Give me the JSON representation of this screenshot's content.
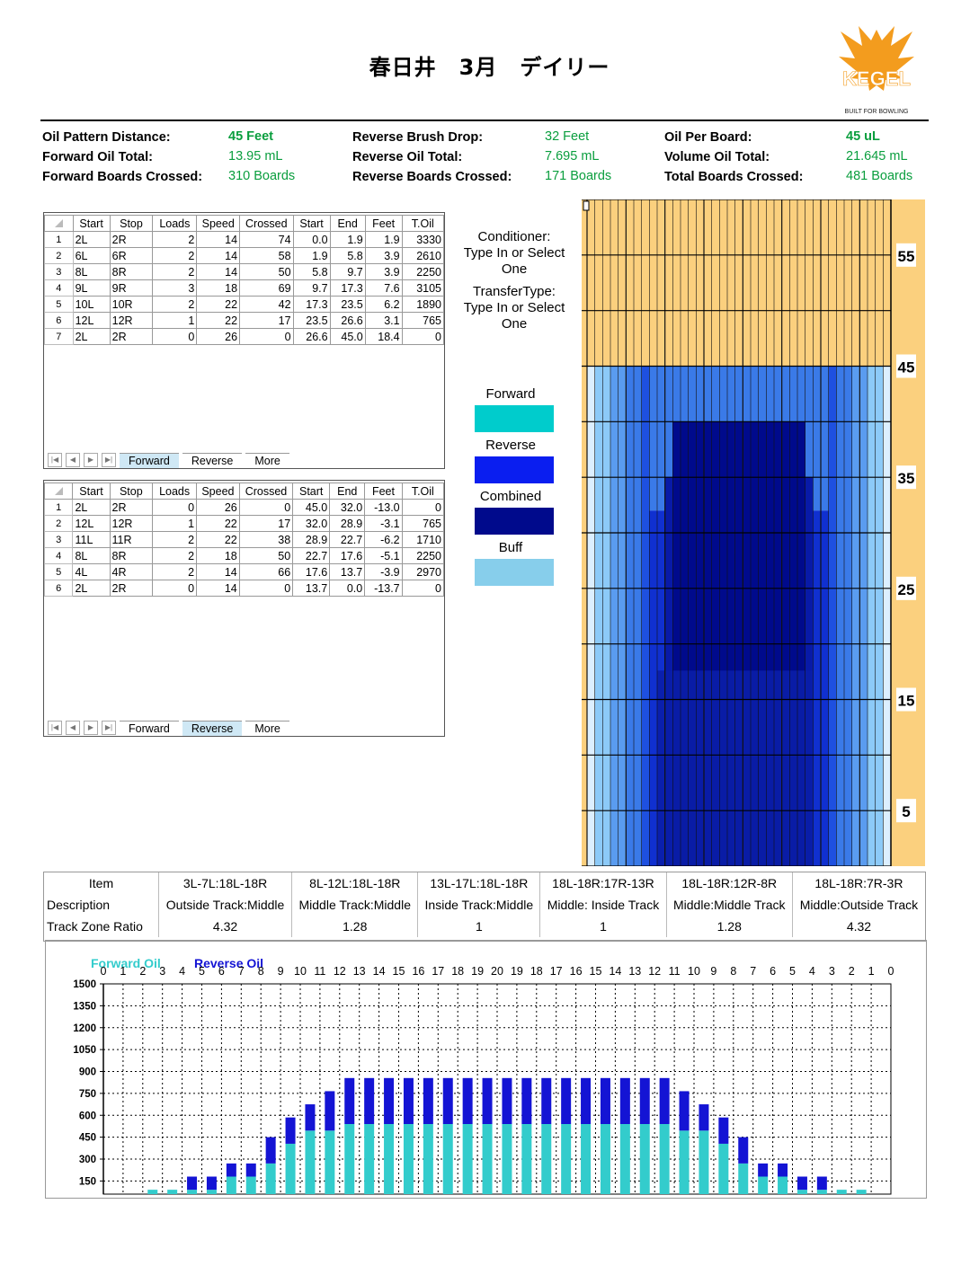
{
  "title": "春日井　3月　デイリー",
  "logo": {
    "text": "KEGEL",
    "tagline": "BUILT FOR BOWLING",
    "color": "#f39c1e"
  },
  "summary": [
    {
      "label": "Oil Pattern Distance:",
      "value": "45 Feet",
      "bold": true
    },
    {
      "label": "Reverse Brush Drop:",
      "value": "32 Feet",
      "bold": false
    },
    {
      "label": "Oil Per Board:",
      "value": "45 uL",
      "bold": true
    },
    {
      "label": "Forward Oil Total:",
      "value": "13.95 mL",
      "bold": false
    },
    {
      "label": "Reverse Oil Total:",
      "value": "7.695 mL",
      "bold": false
    },
    {
      "label": "Volume Oil Total:",
      "value": "21.645 mL",
      "bold": false
    },
    {
      "label": "Forward Boards Crossed:",
      "value": "310 Boards",
      "bold": false
    },
    {
      "label": "Reverse Boards Crossed:",
      "value": "171 Boards",
      "bold": false
    },
    {
      "label": "Total Boards Crossed:",
      "value": "481 Boards",
      "bold": false
    }
  ],
  "grid_headers": [
    "",
    "Start",
    "Stop",
    "Loads",
    "Speed",
    "Crossed",
    "Start",
    "End",
    "Feet",
    "T.Oil"
  ],
  "forward_rows": [
    [
      "1",
      "2L",
      "2R",
      "2",
      "14",
      "74",
      "0.0",
      "1.9",
      "1.9",
      "3330"
    ],
    [
      "2",
      "6L",
      "6R",
      "2",
      "14",
      "58",
      "1.9",
      "5.8",
      "3.9",
      "2610"
    ],
    [
      "3",
      "8L",
      "8R",
      "2",
      "14",
      "50",
      "5.8",
      "9.7",
      "3.9",
      "2250"
    ],
    [
      "4",
      "9L",
      "9R",
      "3",
      "18",
      "69",
      "9.7",
      "17.3",
      "7.6",
      "3105"
    ],
    [
      "5",
      "10L",
      "10R",
      "2",
      "22",
      "42",
      "17.3",
      "23.5",
      "6.2",
      "1890"
    ],
    [
      "6",
      "12L",
      "12R",
      "1",
      "22",
      "17",
      "23.5",
      "26.6",
      "3.1",
      "765"
    ],
    [
      "7",
      "2L",
      "2R",
      "0",
      "26",
      "0",
      "26.6",
      "45.0",
      "18.4",
      "0"
    ]
  ],
  "reverse_rows": [
    [
      "1",
      "2L",
      "2R",
      "0",
      "26",
      "0",
      "45.0",
      "32.0",
      "-13.0",
      "0"
    ],
    [
      "2",
      "12L",
      "12R",
      "1",
      "22",
      "17",
      "32.0",
      "28.9",
      "-3.1",
      "765"
    ],
    [
      "3",
      "11L",
      "11R",
      "2",
      "22",
      "38",
      "28.9",
      "22.7",
      "-6.2",
      "1710"
    ],
    [
      "4",
      "8L",
      "8R",
      "2",
      "18",
      "50",
      "22.7",
      "17.6",
      "-5.1",
      "2250"
    ],
    [
      "5",
      "4L",
      "4R",
      "2",
      "14",
      "66",
      "17.6",
      "13.7",
      "-3.9",
      "2970"
    ],
    [
      "6",
      "2L",
      "2R",
      "0",
      "14",
      "0",
      "13.7",
      "0.0",
      "-13.7",
      "0"
    ]
  ],
  "tabs": [
    "Forward",
    "Reverse",
    "More"
  ],
  "conditioner": {
    "line1": "Conditioner:",
    "line2": "Type In or Select",
    "line3": "One"
  },
  "transfer": {
    "line1": "TransferType:",
    "line2": "Type In or Select",
    "line3": "One"
  },
  "legend": [
    {
      "label": "Forward",
      "color": "#00cccc"
    },
    {
      "label": "Reverse",
      "color": "#0a1ef0"
    },
    {
      "label": "Combined",
      "color": "#000a8c"
    },
    {
      "label": "Buff",
      "color": "#87ceeb"
    }
  ],
  "lane_ruler": [
    "55",
    "45",
    "35",
    "25",
    "15",
    "5"
  ],
  "zone_table": {
    "row_labels": [
      "Item",
      "Description",
      "Track Zone Ratio"
    ],
    "columns": [
      {
        "item": "3L-7L:18L-18R",
        "desc": "Outside Track:Middle",
        "ratio": "4.32"
      },
      {
        "item": "8L-12L:18L-18R",
        "desc": "Middle Track:Middle",
        "ratio": "1.28"
      },
      {
        "item": "13L-17L:18L-18R",
        "desc": "Inside Track:Middle",
        "ratio": "1"
      },
      {
        "item": "18L-18R:17R-13R",
        "desc": "Middle: Inside Track",
        "ratio": "1"
      },
      {
        "item": "18L-18R:12R-8R",
        "desc": "Middle:Middle Track",
        "ratio": "1.28"
      },
      {
        "item": "18L-18R:7R-3R",
        "desc": "Middle:Outside Track",
        "ratio": "4.32"
      }
    ]
  },
  "chart_data": {
    "type": "bar",
    "stacked": true,
    "legend": [
      {
        "name": "Forward Oil",
        "color": "#33cccc"
      },
      {
        "name": "Reverse Oil",
        "color": "#1414d4"
      }
    ],
    "legend_position": "top-left",
    "categories": [
      "0",
      "1",
      "2",
      "3",
      "4",
      "5",
      "6",
      "7",
      "8",
      "9",
      "10",
      "11",
      "12",
      "13",
      "14",
      "15",
      "16",
      "17",
      "18",
      "19",
      "20",
      "19",
      "18",
      "17",
      "16",
      "15",
      "14",
      "13",
      "12",
      "11",
      "10",
      "9",
      "8",
      "7",
      "6",
      "5",
      "4",
      "3",
      "2",
      "1",
      "0"
    ],
    "yticks": [
      "150",
      "300",
      "450",
      "600",
      "750",
      "900",
      "1050",
      "1200",
      "1350",
      "1500"
    ],
    "ylim": [
      60,
      1500
    ],
    "grid": true,
    "series": [
      {
        "name": "Forward Oil",
        "values": [
          0,
          0,
          90,
          90,
          90,
          90,
          180,
          180,
          270,
          405,
          495,
          495,
          540,
          540,
          540,
          540,
          540,
          540,
          540,
          540,
          540,
          540,
          540,
          540,
          540,
          540,
          540,
          540,
          540,
          495,
          495,
          405,
          270,
          180,
          180,
          90,
          90,
          90,
          90,
          0,
          0
        ]
      },
      {
        "name": "Reverse Oil",
        "values": [
          0,
          0,
          0,
          0,
          90,
          90,
          90,
          90,
          180,
          180,
          180,
          270,
          315,
          315,
          315,
          315,
          315,
          315,
          315,
          315,
          315,
          315,
          315,
          315,
          315,
          315,
          315,
          315,
          315,
          270,
          180,
          180,
          180,
          90,
          90,
          90,
          90,
          0,
          0,
          0,
          0
        ]
      }
    ]
  }
}
